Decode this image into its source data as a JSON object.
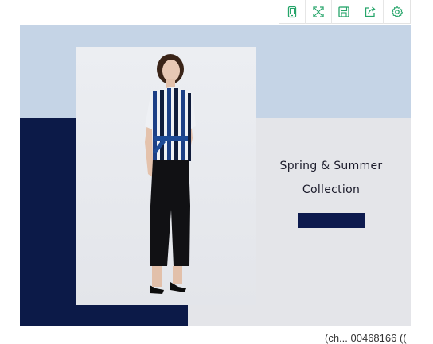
{
  "toolbar": {
    "buttons": [
      {
        "icon": "mobile-icon"
      },
      {
        "icon": "fullscreen-icon"
      },
      {
        "icon": "save-icon"
      },
      {
        "icon": "share-icon"
      },
      {
        "icon": "settings-icon"
      }
    ],
    "icon_color": "#26a56a"
  },
  "banner": {
    "headline_line1": "Spring & Summer",
    "headline_line2": "Collection",
    "cta_label": "",
    "colors": {
      "navy": "#0c1a48",
      "light_blue": "#c5d4e6",
      "light_gray": "#e4e5e9"
    }
  },
  "footer": {
    "partial_text": "(ch... 00468166 (("
  }
}
